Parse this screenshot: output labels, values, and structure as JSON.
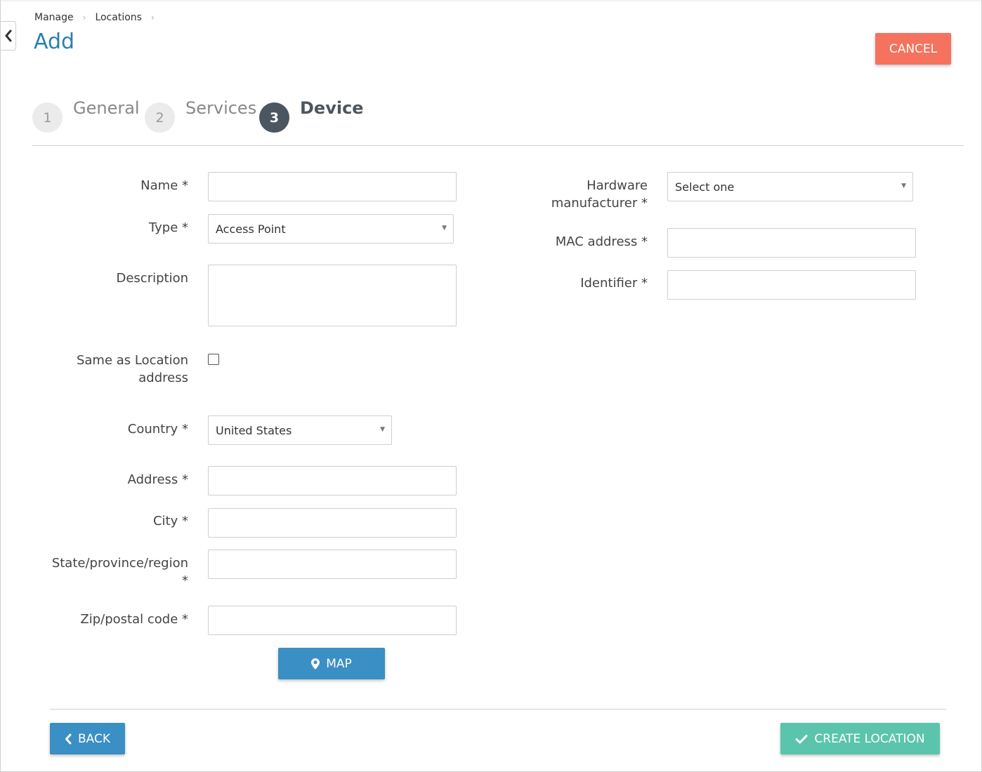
{
  "breadcrumb": [
    {
      "label": "Manage"
    },
    {
      "label": "Locations"
    }
  ],
  "page": {
    "title": "Add"
  },
  "actions": {
    "cancel": "CANCEL",
    "map": "MAP",
    "back": "BACK",
    "create": "CREATE LOCATION"
  },
  "steps": [
    {
      "number": "1",
      "label": "General",
      "active": false
    },
    {
      "number": "2",
      "label": "Services",
      "active": false
    },
    {
      "number": "3",
      "label": "Device",
      "active": true
    }
  ],
  "form": {
    "name": {
      "label": "Name *",
      "value": ""
    },
    "type": {
      "label": "Type *",
      "value": "Access Point"
    },
    "description": {
      "label": "Description",
      "value": ""
    },
    "same_as_location": {
      "label_line1": "Same as Location",
      "label_line2": "address",
      "checked": false
    },
    "country": {
      "label": "Country *",
      "value": "United States"
    },
    "address": {
      "label": "Address *",
      "value": ""
    },
    "city": {
      "label": "City *",
      "value": ""
    },
    "state": {
      "label_line1": "State/province/region",
      "label_line2": "*",
      "value": ""
    },
    "zip": {
      "label": "Zip/postal code *",
      "value": ""
    },
    "hardware_manufacturer": {
      "label_line1": "Hardware",
      "label_line2": "manufacturer *",
      "value": "Select one"
    },
    "mac_address": {
      "label": "MAC address *",
      "value": ""
    },
    "identifier": {
      "label": "Identifier *",
      "value": ""
    }
  },
  "colors": {
    "title": "#2a7fb2",
    "cancel": "#f4725e",
    "primary": "#3a8fc4",
    "success": "#5bc4ac",
    "step_active": "#4c5660"
  },
  "icons": {
    "collapse": "chevron-left-icon",
    "breadcrumb_separator": "chevron-right-icon",
    "map": "map-marker-icon",
    "back": "chevron-left-icon",
    "create": "check-icon",
    "select": "caret-down-icon"
  }
}
